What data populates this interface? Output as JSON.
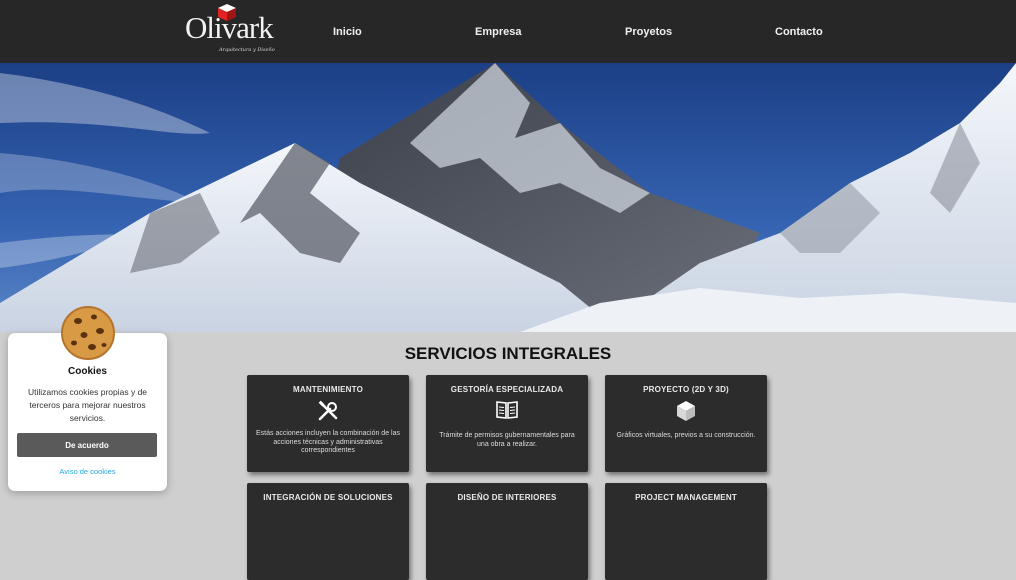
{
  "brand": {
    "name": "Olivark",
    "tagline": "Arquitectura y Diseño"
  },
  "nav": [
    {
      "label": "Inicio"
    },
    {
      "label": "Empresa"
    },
    {
      "label": "Proyetos"
    },
    {
      "label": "Contacto"
    }
  ],
  "services": {
    "title": "SERVICIOS INTEGRALES",
    "cards": [
      {
        "title": "MANTENIMIENTO",
        "icon": "tools-icon",
        "desc": "Estás acciones incluyen la combinación de las acciones técnicas y administrativas correspondientes"
      },
      {
        "title": "GESTORÍA ESPECIALIZADA",
        "icon": "book-icon",
        "desc": "Trámite de permisos gubernamentales para una obra a realizar."
      },
      {
        "title": "PROYECTO (2D Y 3D)",
        "icon": "cube-icon",
        "desc": "Gráficos virtuales, previos a su construcción."
      },
      {
        "title": "INTEGRACIÓN DE SOLUCIONES"
      },
      {
        "title": "DISEÑO DE INTERIORES"
      },
      {
        "title": "PROJECT MANAGEMENT"
      }
    ]
  },
  "cookies": {
    "title": "Cookies",
    "text": "Utilizamos cookies propias y de terceros para mejorar nuestros servicios.",
    "accept_label": "De acuerdo",
    "policy_label": "Aviso de cookies"
  },
  "colors": {
    "header_bg": "#272727",
    "card_bg": "#2c2c2c",
    "page_bg": "#cfcfcf",
    "link": "#2aa8e0",
    "logo_accent": "#d32222"
  }
}
